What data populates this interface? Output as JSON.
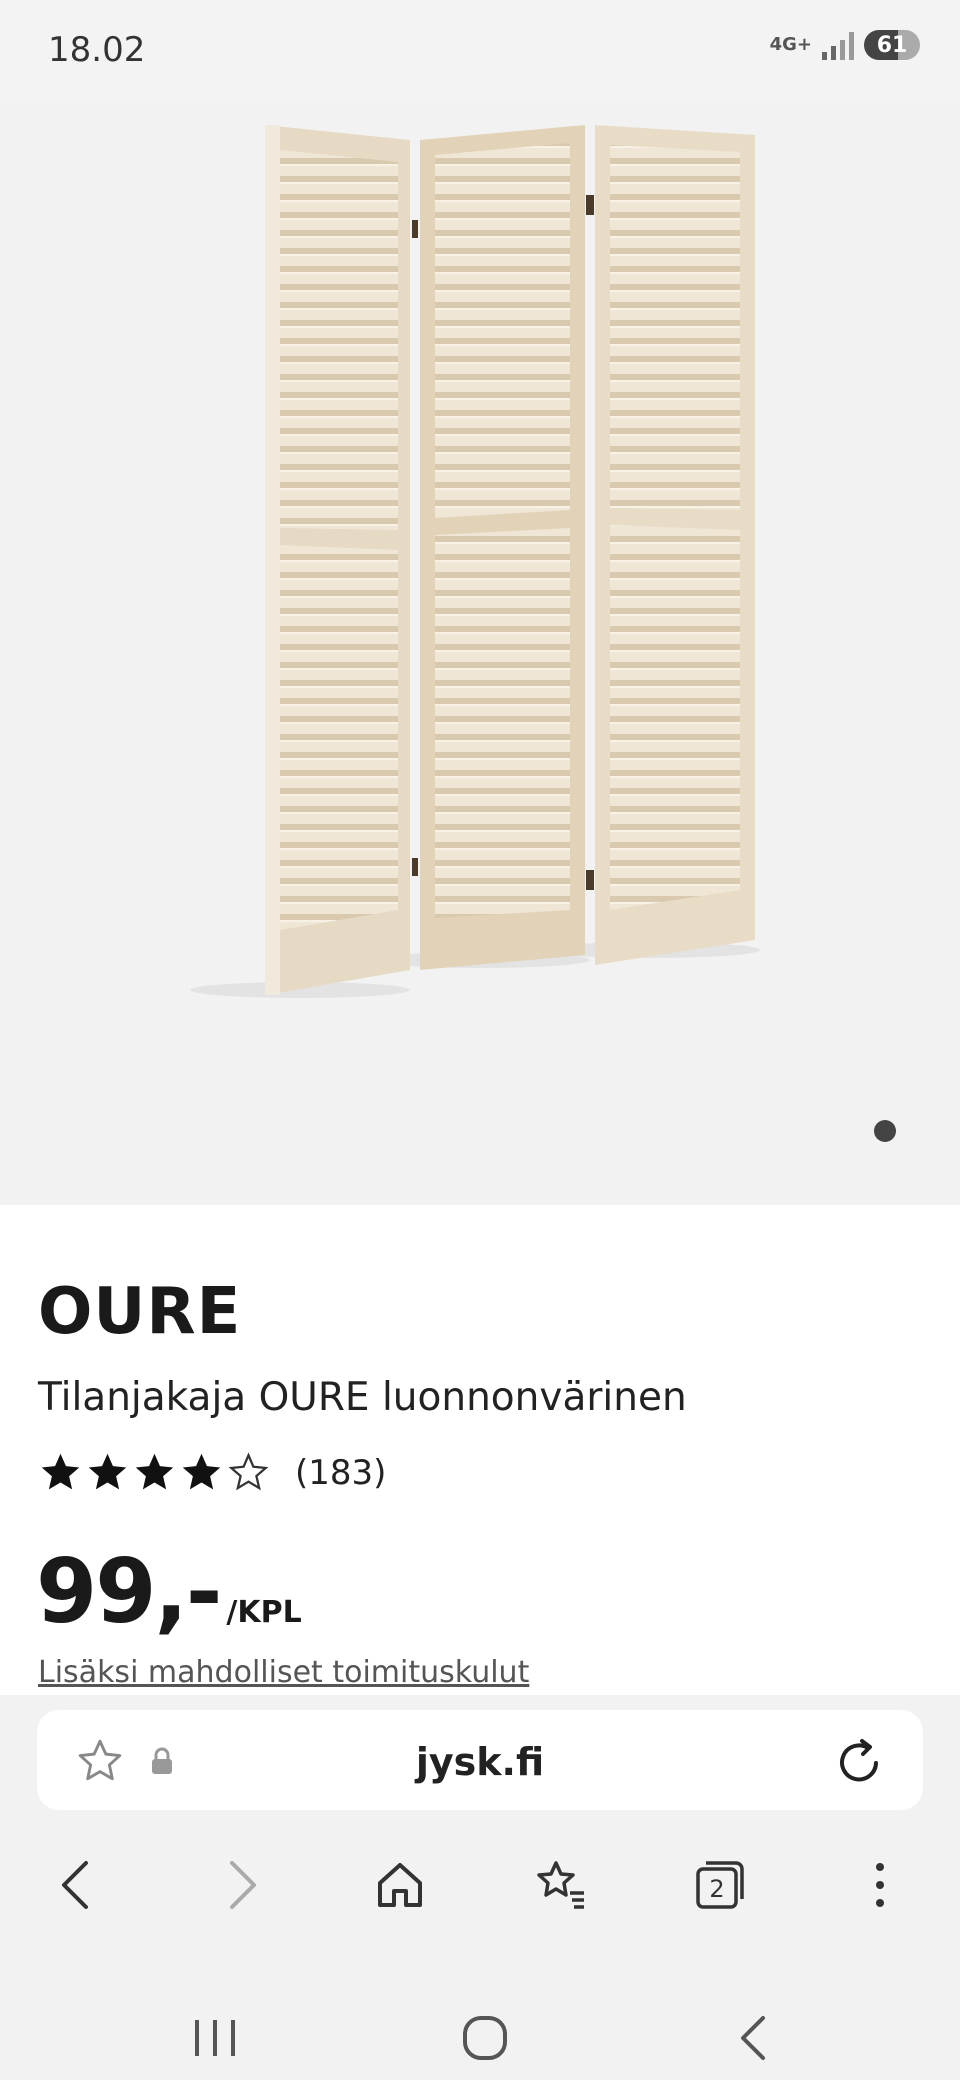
{
  "status_bar": {
    "time": "18.02",
    "network": "4G+",
    "battery": "61"
  },
  "product": {
    "brand": "OURE",
    "subtitle": "Tilanjakaja OURE luonnonvärinen",
    "rating": {
      "stars_filled": 4,
      "stars_total": 5,
      "count": "(183)"
    },
    "price": "99,-",
    "unit": "/KPL",
    "shipping_note": "Lisäksi mahdolliset toimituskulut",
    "carousel": {
      "total": 1,
      "active": 1
    }
  },
  "browser": {
    "url": "jysk.fi",
    "icons": {
      "bookmark": "star-outline-icon",
      "secure": "lock-icon",
      "reload": "reload-icon",
      "back": "back-icon",
      "forward": "forward-icon",
      "home": "home-icon",
      "bookmarks": "bookmarks-icon",
      "tabs": "tabs-icon",
      "menu": "more-vertical-icon"
    },
    "tab_count": "2"
  },
  "colors": {
    "accent_dark": "#1a1a1a",
    "wood_light": "#ece1cf",
    "wood_shadow": "#d2c1a6"
  }
}
